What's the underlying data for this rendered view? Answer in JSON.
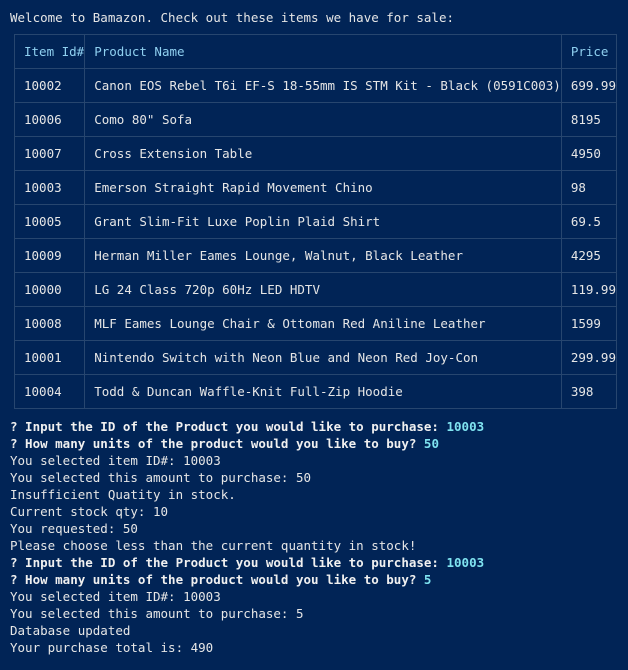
{
  "colors": {
    "background": "#012456",
    "text": "#e6e6e6",
    "header_text": "#8fd0f0",
    "answer_text": "#7fe3f0",
    "border": "#27466f"
  },
  "welcome": "Welcome to Bamazon. Check out these items we have for sale:",
  "table": {
    "headers": [
      "Item Id#",
      "Product Name",
      "Price"
    ],
    "rows": [
      [
        "10002",
        "Canon EOS Rebel T6i EF-S 18-55mm IS STM Kit - Black (0591C003)",
        "699.99"
      ],
      [
        "10006",
        "Como 80\" Sofa",
        "8195"
      ],
      [
        "10007",
        "Cross Extension Table",
        "4950"
      ],
      [
        "10003",
        "Emerson Straight Rapid Movement Chino",
        "98"
      ],
      [
        "10005",
        "Grant Slim-Fit Luxe Poplin Plaid Shirt",
        "69.5"
      ],
      [
        "10009",
        "Herman Miller Eames Lounge, Walnut, Black Leather",
        "4295"
      ],
      [
        "10000",
        "LG 24 Class 720p 60Hz LED HDTV",
        "119.99"
      ],
      [
        "10008",
        "MLF Eames Lounge Chair & Ottoman Red Aniline Leather",
        "1599"
      ],
      [
        "10001",
        "Nintendo Switch with Neon Blue and Neon Red Joy-Con",
        "299.99"
      ],
      [
        "10004",
        "Todd & Duncan Waffle-Knit Full-Zip Hoodie",
        "398"
      ]
    ]
  },
  "session": [
    {
      "prompt": "? Input the ID of the Product you would like to purchase: ",
      "answer": "10003"
    },
    {
      "prompt": "? How many units of the product would you like to buy? ",
      "answer": "50"
    },
    {
      "text": "You selected item ID#: 10003"
    },
    {
      "text": "You selected this amount to purchase: 50"
    },
    {
      "text": "Insufficient Quatity in stock."
    },
    {
      "text": "Current stock qty: 10"
    },
    {
      "text": "You requested: 50"
    },
    {
      "text": "Please choose less than the current quantity in stock!"
    },
    {
      "prompt": "? Input the ID of the Product you would like to purchase: ",
      "answer": "10003"
    },
    {
      "prompt": "? How many units of the product would you like to buy? ",
      "answer": "5"
    },
    {
      "text": "You selected item ID#: 10003"
    },
    {
      "text": "You selected this amount to purchase: 5"
    },
    {
      "text": "Database updated"
    },
    {
      "text": "Your purchase total is: 490"
    }
  ]
}
